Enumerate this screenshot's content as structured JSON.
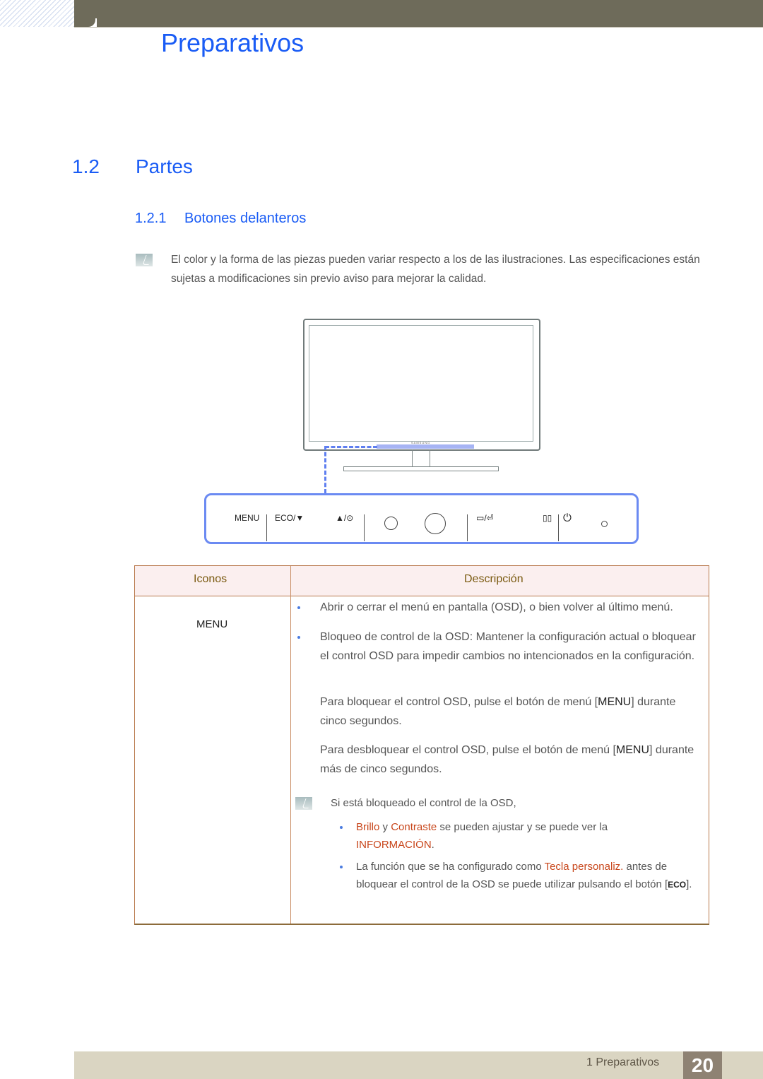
{
  "header": {
    "chapter_title": "Preparativos"
  },
  "section": {
    "number": "1.2",
    "title": "Partes"
  },
  "subsection": {
    "number": "1.2.1",
    "title": "Botones delanteros"
  },
  "note": {
    "icon": "note-pencil-icon",
    "text": "El color y la forma de las piezas pueden variar respecto a los de las ilustraciones. Las especificaciones están sujetas a modificaciones sin previo aviso para mejorar la calidad."
  },
  "illustration": {
    "brand": "SAMSUNG",
    "panel_buttons": [
      {
        "label": "MENU"
      },
      {
        "label": "ECO/▼"
      },
      {
        "label": "▲/⊙"
      },
      {
        "label": "○"
      },
      {
        "label": "◯"
      },
      {
        "label": "▭/⏎"
      },
      {
        "label": "▯▯"
      },
      {
        "label": "⏻"
      },
      {
        "label": "○"
      }
    ]
  },
  "table": {
    "headers": [
      "Iconos",
      "Descripción"
    ],
    "row": {
      "icon_label": "MENU",
      "bullets": [
        "Abrir o cerrar el menú en pantalla (OSD), o bien volver al último menú.",
        "Bloqueo de control de la OSD: Mantener la configuración actual o bloquear el control OSD para impedir cambios no intencionados en la configuración."
      ],
      "lock_text_prefix": "Para bloquear el control OSD, pulse el botón de menú [",
      "lock_key": "MENU",
      "lock_text_suffix": "] durante cinco segundos.",
      "unlock_text_prefix": "Para desbloquear el control OSD, pulse el botón de menú [",
      "unlock_key": "MENU",
      "unlock_text_suffix": "] durante más de cinco segundos.",
      "subnote": {
        "intro": "Si está bloqueado el control de la OSD,",
        "item1": {
          "brillo": "Brillo",
          "y": " y ",
          "contraste": "Contraste",
          "mid": " se pueden ajustar y se puede ver la ",
          "info": "INFORMACIÓN",
          "end": "."
        },
        "item2": {
          "pre": "La función que se ha configurado como ",
          "key": "Tecla personaliz.",
          "post": " antes de bloquear el control de la OSD se puede utilizar pulsando el botón [",
          "eco": "ECO",
          "end": "]."
        }
      }
    }
  },
  "footer": {
    "chapter": "1 Preparativos",
    "page": "20"
  }
}
